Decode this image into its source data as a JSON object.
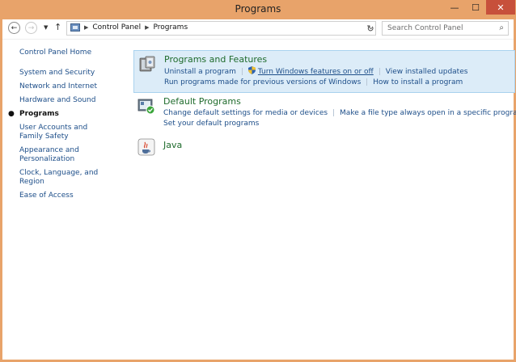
{
  "window": {
    "title": "Programs"
  },
  "controls": {
    "minimize": "—",
    "maximize": "☐",
    "close": "✕"
  },
  "address": {
    "crumbs": [
      "Control Panel",
      "Programs"
    ],
    "search_placeholder": "Search Control Panel"
  },
  "left_nav": {
    "home": "Control Panel Home",
    "items": [
      "System and Security",
      "Network and Internet",
      "Hardware and Sound",
      "Programs",
      "User Accounts and Family Safety",
      "Appearance and Personalization",
      "Clock, Language, and Region",
      "Ease of Access"
    ],
    "current_index": 3
  },
  "sections": {
    "programs_features": {
      "title": "Programs and Features",
      "links_row1": [
        "Uninstall a program",
        "Turn Windows features on or off",
        "View installed updates"
      ],
      "links_row2": [
        "Run programs made for previous versions of Windows",
        "How to install a program"
      ]
    },
    "default_programs": {
      "title": "Default Programs",
      "links_row1": [
        "Change default settings for media or devices",
        "Make a file type always open in a specific program"
      ],
      "links_row2": [
        "Set your default programs"
      ]
    },
    "java": {
      "title": "Java"
    }
  }
}
